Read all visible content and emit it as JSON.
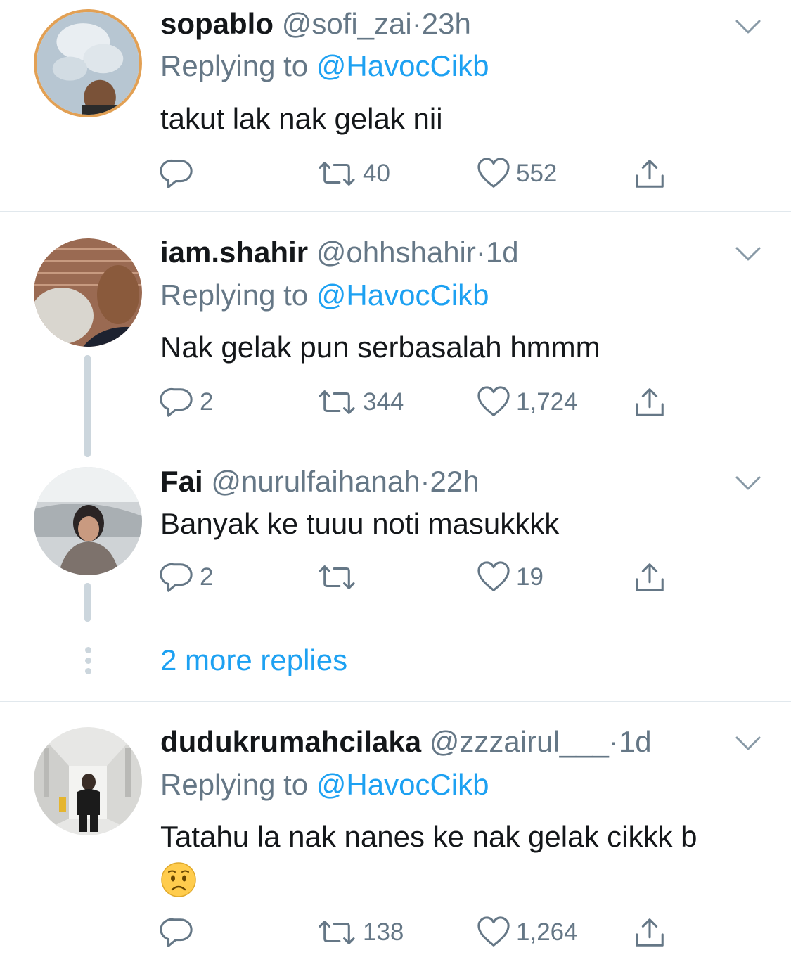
{
  "tweets": [
    {
      "display_name": "sopablo",
      "handle": "@sofi_zai",
      "sep": "·",
      "time": "23h",
      "replying_prefix": "Replying to ",
      "replying_to": "@HavocCikb",
      "text": "takut lak nak gelak nii",
      "replies": "",
      "retweets": "40",
      "likes": "552"
    },
    {
      "display_name": "iam.shahir",
      "handle": "@ohhshahir",
      "sep": "·",
      "time": "1d",
      "replying_prefix": "Replying to ",
      "replying_to": "@HavocCikb",
      "text": "Nak gelak pun serbasalah hmmm",
      "replies": "2",
      "retweets": "344",
      "likes": "1,724"
    },
    {
      "display_name": "Fai",
      "handle": "@nurulfaihanah",
      "sep": "·",
      "time": "22h",
      "text": "Banyak ke tuuu noti masukkkk",
      "replies": "2",
      "retweets": "",
      "likes": "19"
    },
    {
      "display_name": "dudukrumahcilaka",
      "handle": "@zzzairul___",
      "sep": "·",
      "time": "1d",
      "replying_prefix": "Replying to ",
      "replying_to": "@HavocCikb",
      "text": "Tatahu la nak nanes ke nak gelak cikkk b",
      "emoji": "worried-face",
      "replies": "",
      "retweets": "138",
      "likes": "1,264"
    }
  ],
  "more_replies": "2 more replies",
  "colors": {
    "accent": "#1da1f2",
    "secondary_text": "#657786",
    "primary_text": "#14171a",
    "divider": "#e1e8ed",
    "thread_line": "#ccd6dd"
  },
  "icons": [
    "chevron-down-icon",
    "reply-icon",
    "retweet-icon",
    "like-icon",
    "share-icon"
  ]
}
